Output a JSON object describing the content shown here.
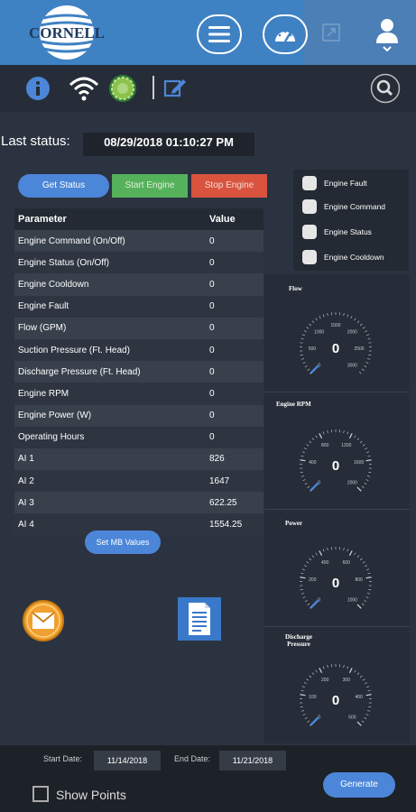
{
  "header": {
    "logo_text": "CORNELL"
  },
  "icons": {
    "menu": "hamburger-icon",
    "dashboard": "speedometer-icon",
    "expand": "expand-icon",
    "user": "user-icon",
    "info": "info-icon",
    "wifi": "wifi-icon",
    "status": "status-light-icon",
    "edit": "edit-icon",
    "search": "search-icon",
    "mail": "mail-icon",
    "document": "document-icon"
  },
  "status": {
    "label": "Last status:",
    "value": "08/29/2018 01:10:27 PM"
  },
  "buttons": {
    "get_status": "Get Status",
    "start_engine": "Start Engine",
    "stop_engine": "Stop Engine",
    "set_mb": "Set MB Values",
    "generate": "Generate"
  },
  "table": {
    "headers": [
      "Parameter",
      "Value"
    ],
    "rows": [
      {
        "param": "Engine Command (On/Off)",
        "value": "0"
      },
      {
        "param": "Engine Status (On/Off)",
        "value": "0"
      },
      {
        "param": "Engine Cooldown",
        "value": "0"
      },
      {
        "param": "Engine Fault",
        "value": "0"
      },
      {
        "param": "Flow (GPM)",
        "value": "0"
      },
      {
        "param": "Suction Pressure (Ft. Head)",
        "value": "0"
      },
      {
        "param": "Discharge Pressure (Ft. Head)",
        "value": "0"
      },
      {
        "param": "Engine RPM",
        "value": "0"
      },
      {
        "param": "Engine Power (W)",
        "value": "0"
      },
      {
        "param": "Operating Hours",
        "value": "0"
      },
      {
        "param": "AI 1",
        "value": "826"
      },
      {
        "param": "AI 2",
        "value": "1647"
      },
      {
        "param": "AI 3",
        "value": "622.25"
      },
      {
        "param": "AI 4",
        "value": "1554.25"
      }
    ]
  },
  "checkboxes": [
    {
      "label": "Engine Fault",
      "checked": false
    },
    {
      "label": "Engine Command",
      "checked": false
    },
    {
      "label": "Engine Status",
      "checked": false
    },
    {
      "label": "Engine Cooldown",
      "checked": false
    }
  ],
  "gauges": [
    {
      "title": "Flow",
      "value": "0",
      "ticks": [
        "0",
        "500",
        "1000",
        "1500",
        "2000",
        "2500",
        "3000"
      ]
    },
    {
      "title": "Engine RPM",
      "value": "0",
      "ticks": [
        "0",
        "400",
        "800",
        "1200",
        "1600",
        "2000"
      ]
    },
    {
      "title": "Power",
      "value": "0",
      "ticks": [
        "0",
        "200",
        "400",
        "600",
        "800",
        "1000"
      ]
    },
    {
      "title": "Discharge Pressure",
      "value": "0",
      "ticks": [
        "0",
        "100",
        "200",
        "300",
        "400",
        "500"
      ]
    }
  ],
  "footer": {
    "start_label": "Start Date:",
    "start_value": "11/14/2018",
    "end_label": "End Date:",
    "end_value": "11/21/2018",
    "show_points": "Show Points"
  },
  "colors": {
    "header_blue": "#3f82c4",
    "primary_button": "#4c86d8",
    "start_green": "#56b15b",
    "stop_red": "#d9533e",
    "status_light": "#8bc34a",
    "mail_orange": "#f0a030"
  }
}
